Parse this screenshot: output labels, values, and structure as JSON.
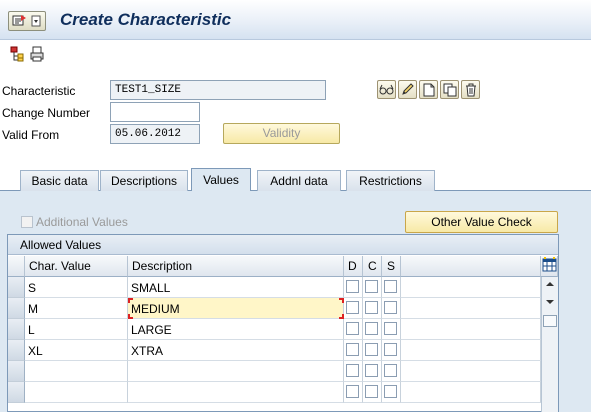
{
  "title": "Create Characteristic",
  "form": {
    "characteristic_label": "Characteristic",
    "characteristic_value": "TEST1_SIZE",
    "change_number_label": "Change Number",
    "change_number_value": "",
    "valid_from_label": "Valid From",
    "valid_from_value": "05.06.2012",
    "validity_button": "Validity"
  },
  "tabs": [
    {
      "label": "Basic data"
    },
    {
      "label": "Descriptions"
    },
    {
      "label": "Values",
      "active": true
    },
    {
      "label": "Addnl data"
    },
    {
      "label": "Restrictions"
    }
  ],
  "values_tab": {
    "additional_values_label": "Additional Values",
    "additional_values_checked": false,
    "other_value_check_button": "Other Value Check",
    "allowed_values_title": "Allowed Values",
    "columns": {
      "char_value": "Char. Value",
      "description": "Description",
      "d": "D",
      "c": "C",
      "s": "S"
    },
    "rows": [
      {
        "value": "S",
        "description": "SMALL"
      },
      {
        "value": "M",
        "description": "MEDIUM"
      },
      {
        "value": "L",
        "description": "LARGE"
      },
      {
        "value": "XL",
        "description": "XTRA"
      },
      {
        "value": "",
        "description": ""
      },
      {
        "value": "",
        "description": ""
      }
    ]
  },
  "icons": [
    "menu-icon",
    "hierarchy-icon",
    "print-icon",
    "glasses-icon",
    "pencil-icon",
    "new-document-icon",
    "copy-icon",
    "delete-icon",
    "table-settings-icon"
  ]
}
